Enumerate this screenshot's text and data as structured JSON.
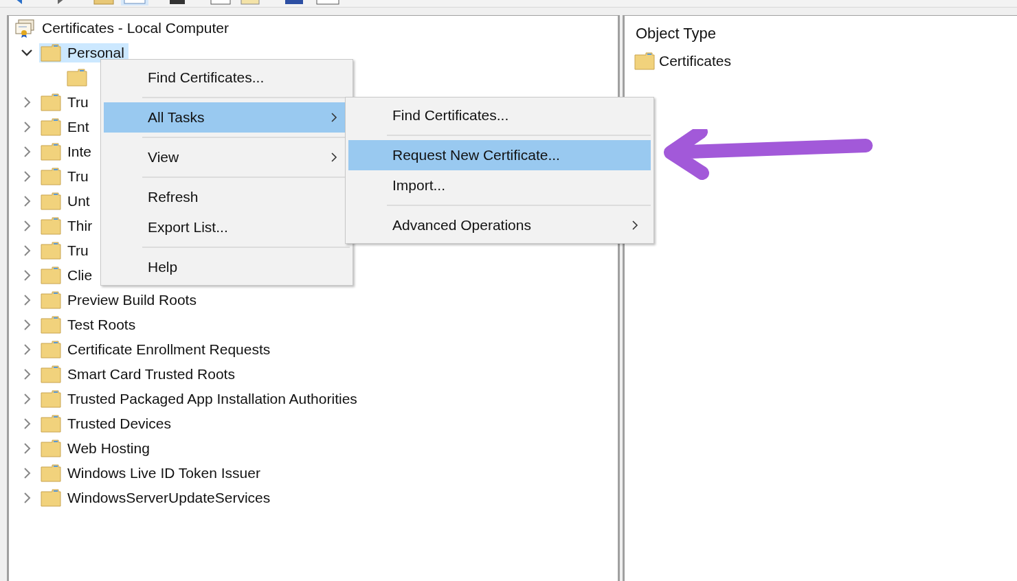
{
  "tree": {
    "root": {
      "label": "Certificates - Local Computer",
      "children": [
        {
          "label": "Personal",
          "selected": true,
          "expanded": true,
          "children": [
            {
              "selected": false
            }
          ]
        },
        {
          "label": "Tru",
          "selected": false,
          "expanded": false
        },
        {
          "label": "Ent",
          "selected": false,
          "expanded": false
        },
        {
          "label": "Inte",
          "selected": false,
          "expanded": false
        },
        {
          "label": "Tru",
          "selected": false,
          "expanded": false
        },
        {
          "label": "Unt",
          "selected": false,
          "expanded": false
        },
        {
          "label": "Thir",
          "selected": false,
          "expanded": false
        },
        {
          "label": "Tru",
          "selected": false,
          "expanded": false
        },
        {
          "label": "Clie",
          "selected": false,
          "expanded": false
        },
        {
          "label": "Preview Build Roots",
          "selected": false,
          "expanded": false
        },
        {
          "label": "Test Roots",
          "selected": false,
          "expanded": false
        },
        {
          "label": "Certificate Enrollment Requests",
          "selected": false,
          "expanded": false
        },
        {
          "label": "Smart Card Trusted Roots",
          "selected": false,
          "expanded": false
        },
        {
          "label": "Trusted Packaged App Installation Authorities",
          "selected": false,
          "expanded": false
        },
        {
          "label": "Trusted Devices",
          "selected": false,
          "expanded": false
        },
        {
          "label": "Web Hosting",
          "selected": false,
          "expanded": false
        },
        {
          "label": "Windows Live ID Token Issuer",
          "selected": false,
          "expanded": false
        },
        {
          "label": "WindowsServerUpdateServices",
          "selected": false,
          "expanded": false
        }
      ]
    }
  },
  "details": {
    "columns": [
      "Object Type"
    ],
    "rows": [
      {
        "label": "Certificates"
      }
    ]
  },
  "context_menu": {
    "groups": [
      [
        {
          "label": "Find Certificates...",
          "selected": false,
          "submenu": false
        }
      ],
      [
        {
          "label": "All Tasks",
          "selected": true,
          "submenu": true
        }
      ],
      [
        {
          "label": "View",
          "selected": false,
          "submenu": true
        }
      ],
      [
        {
          "label": "Refresh",
          "selected": false,
          "submenu": false
        },
        {
          "label": "Export List...",
          "selected": false,
          "submenu": false
        }
      ],
      [
        {
          "label": "Help",
          "selected": false,
          "submenu": false
        }
      ]
    ]
  },
  "submenu": {
    "groups": [
      [
        {
          "label": "Find Certificates...",
          "selected": false,
          "submenu": false
        }
      ],
      [
        {
          "label": "Request New Certificate...",
          "selected": true,
          "submenu": false
        },
        {
          "label": "Import...",
          "selected": false,
          "submenu": false
        }
      ],
      [
        {
          "label": "Advanced Operations",
          "selected": false,
          "submenu": true
        }
      ]
    ]
  }
}
